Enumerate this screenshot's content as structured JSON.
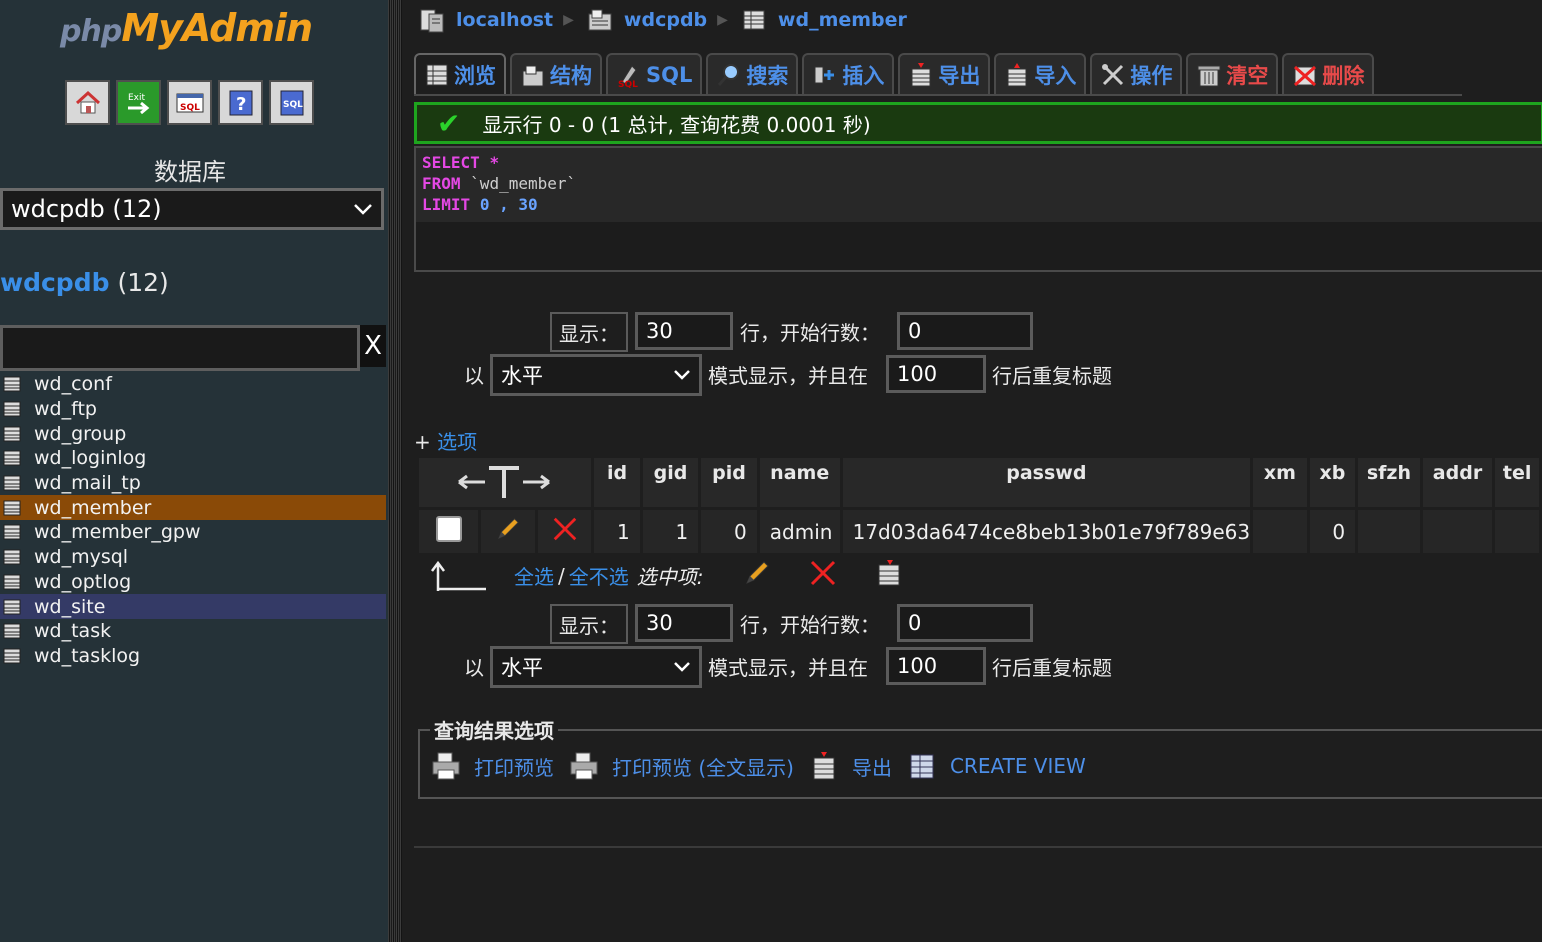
{
  "sidebar": {
    "logo_php": "php",
    "logo_myadmin": "MyAdmin",
    "db_label": "数据库",
    "db_select_value": "wdcpdb (12)",
    "db_title_name": "wdcpdb",
    "db_title_count": "(12)",
    "filter_clear": "X",
    "tables": [
      "wd_conf",
      "wd_ftp",
      "wd_group",
      "wd_loginlog",
      "wd_mail_tp",
      "wd_member",
      "wd_member_gpw",
      "wd_mysql",
      "wd_optlog",
      "wd_site",
      "wd_task",
      "wd_tasklog"
    ],
    "active_table": "wd_member",
    "hover_table": "wd_site",
    "icons": [
      "home-icon",
      "exit-icon",
      "sql-icon",
      "help-icon",
      "query-window-icon"
    ]
  },
  "breadcrumb": {
    "server": "localhost",
    "database": "wdcpdb",
    "table": "wd_member"
  },
  "tabs": [
    {
      "label": "浏览",
      "icon": "browse-icon",
      "active": true
    },
    {
      "label": "结构",
      "icon": "structure-icon"
    },
    {
      "label": "SQL",
      "icon": "sql-icon"
    },
    {
      "label": "搜索",
      "icon": "search-icon"
    },
    {
      "label": "插入",
      "icon": "insert-icon"
    },
    {
      "label": "导出",
      "icon": "export-icon"
    },
    {
      "label": "导入",
      "icon": "import-icon"
    },
    {
      "label": "操作",
      "icon": "operations-icon"
    },
    {
      "label": "清空",
      "icon": "empty-icon",
      "warn": true
    },
    {
      "label": "删除",
      "icon": "drop-icon",
      "warn": true
    }
  ],
  "success_message": "显示行 0 - 0 (1 总计, 查询花费 0.0001 秒)",
  "sql": {
    "select": "SELECT",
    "star": "*",
    "from": "FROM",
    "table": "`wd_member`",
    "limit": "LIMIT",
    "offset": "0",
    "comma": ",",
    "count": "30"
  },
  "nav": {
    "show_label": "显示：",
    "rows_value": "30",
    "rows_suffix": "行，开始行数：",
    "start_value": "0",
    "mode_prefix": "以",
    "mode_value": "水平",
    "mode_suffix": "模式显示，并且在",
    "repeat_value": "100",
    "repeat_suffix": "行后重复标题"
  },
  "options_plus": "+",
  "options_label": "选项",
  "table": {
    "columns": [
      "id",
      "gid",
      "pid",
      "name",
      "passwd",
      "xm",
      "xb",
      "sfzh",
      "addr",
      "tel"
    ],
    "rows": [
      {
        "id": "1",
        "gid": "1",
        "pid": "0",
        "name": "admin",
        "passwd": "17d03da6474ce8beb13b01e79f789e63",
        "xm": "",
        "xb": "0",
        "sfzh": "",
        "addr": "",
        "tel": ""
      }
    ]
  },
  "selection": {
    "check_all": "全选",
    "slash": "/",
    "uncheck_all": "全不选",
    "with_selected": "选中项:"
  },
  "query_results": {
    "legend": "查询结果选项",
    "print_view": "打印预览",
    "print_view_full": "打印预览 (全文显示)",
    "export": "导出",
    "create_view": "CREATE VIEW"
  },
  "colors": {
    "link": "#4d8fe8",
    "active_row": "#8a4a07",
    "success_border": "#1ea51e",
    "warn": "#e84a4a"
  }
}
